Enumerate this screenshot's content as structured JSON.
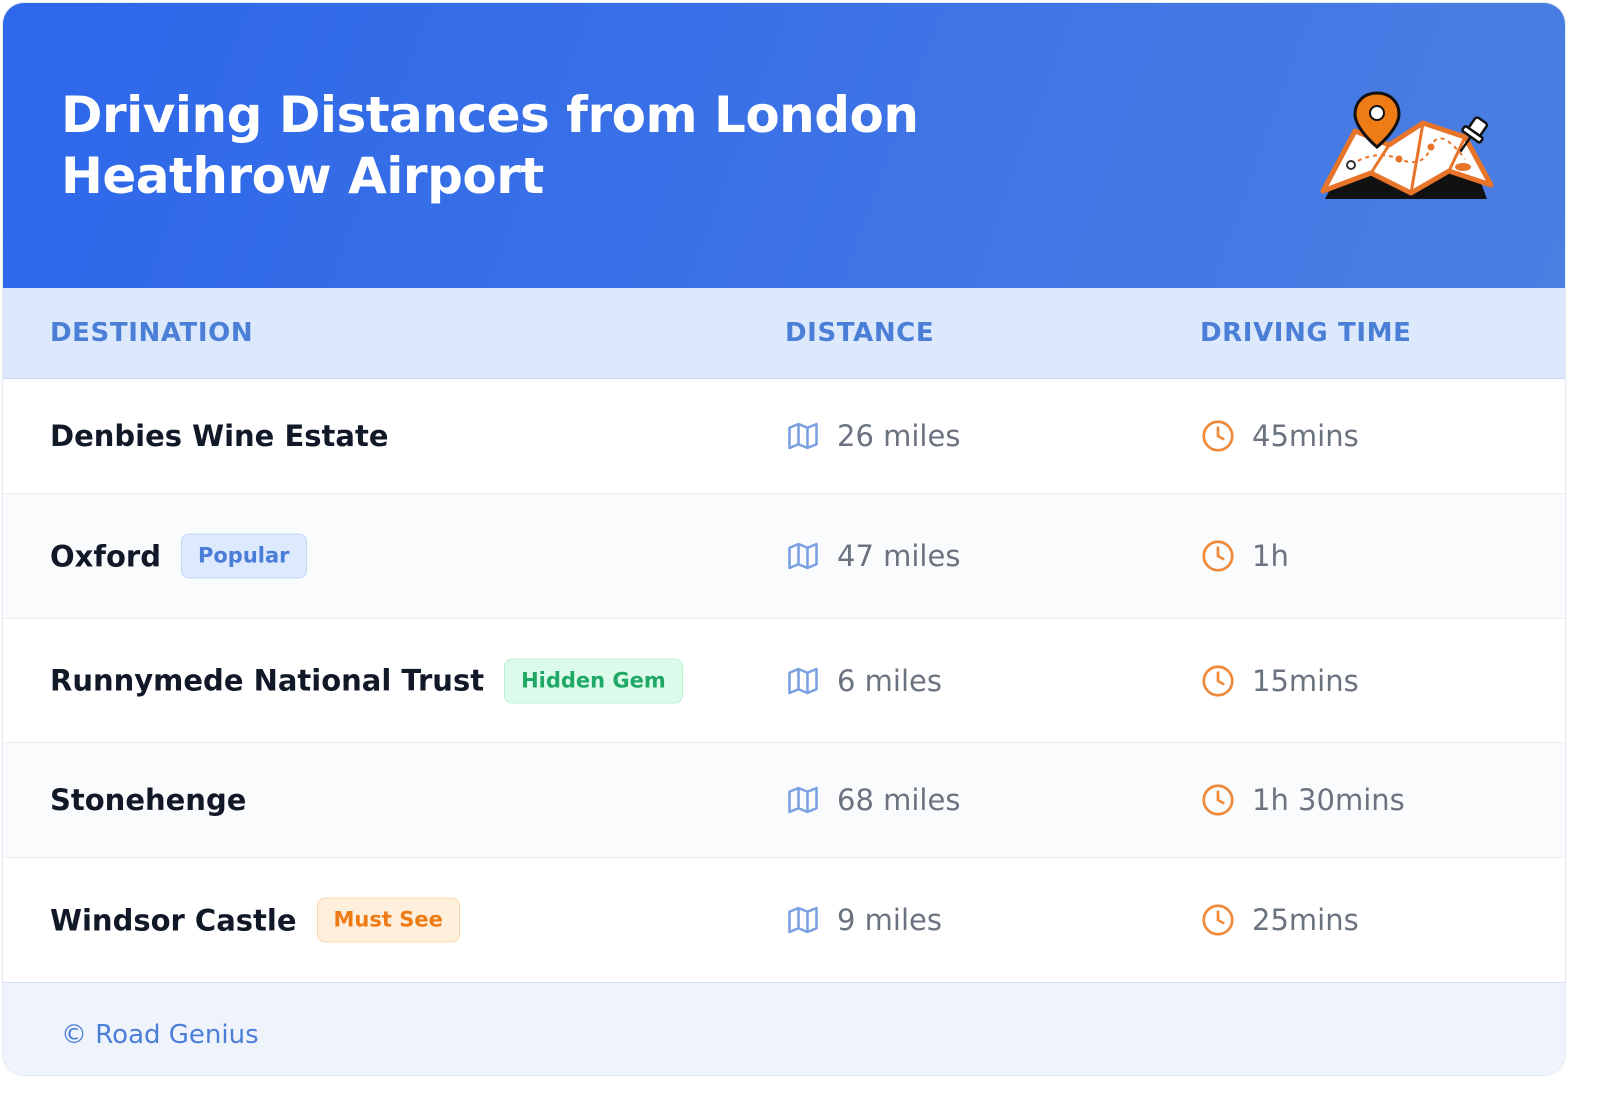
{
  "header": {
    "title": "Driving Distances from London Heathrow Airport",
    "illustration": "map-with-pins-icon"
  },
  "columns": {
    "destination": "DESTINATION",
    "distance": "DISTANCE",
    "driving_time": "DRIVING TIME"
  },
  "icons": {
    "distance": "map-icon",
    "time": "clock-icon"
  },
  "colors": {
    "header_blue": "#2d67ea",
    "table_head_bg": "#dce8fb",
    "accent_blue": "#4b7fd7",
    "clock_orange": "#ef8a3a"
  },
  "rows": [
    {
      "destination": "Denbies Wine Estate",
      "badge": "",
      "distance": "26 miles",
      "time": "45mins"
    },
    {
      "destination": "Oxford",
      "badge": "Popular",
      "distance": "47 miles",
      "time": "1h"
    },
    {
      "destination": "Runnymede National Trust",
      "badge": "Hidden Gem",
      "distance": "6 miles",
      "time": "15mins"
    },
    {
      "destination": "Stonehenge",
      "badge": "",
      "distance": "68 miles",
      "time": "1h 30mins"
    },
    {
      "destination": "Windsor Castle",
      "badge": "Must See",
      "distance": "9 miles",
      "time": "25mins"
    }
  ],
  "footer": {
    "credit": "© Road Genius"
  }
}
